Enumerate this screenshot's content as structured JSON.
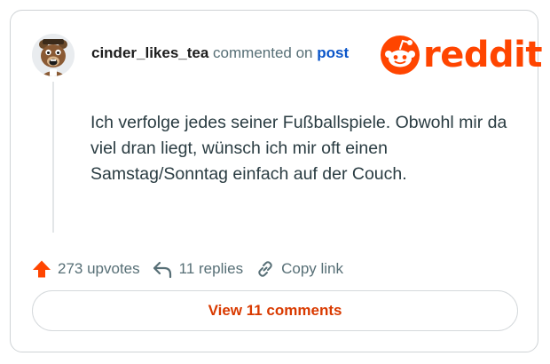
{
  "comment": {
    "username": "cinder_likes_tea",
    "action_text": "commented on",
    "post_link": "post",
    "body": "Ich verfolge jedes seiner Fußballspiele. Obwohl mir da viel dran liegt, wünsch ich mir oft einen Samstag/Sonntag einfach auf der Couch."
  },
  "brand": {
    "wordmark": "reddit",
    "icon": "reddit-snoo-icon",
    "color": "#ff4500"
  },
  "actions": {
    "upvotes_label": "273 upvotes",
    "replies_label": "11 replies",
    "copy_label": "Copy link",
    "upvote_color": "#ff4500"
  },
  "view_comments_label": "View 11 comments",
  "colors": {
    "username": "#1c1c1c",
    "muted": "#576f76",
    "link": "#0a55c9",
    "button_text": "#d93a00"
  }
}
